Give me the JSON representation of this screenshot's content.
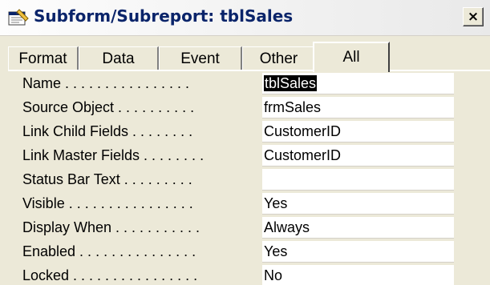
{
  "window": {
    "title": "Subform/Subreport: tblSales",
    "close_label": "×"
  },
  "tabs": [
    {
      "label": "Format",
      "active": false
    },
    {
      "label": "Data",
      "active": false
    },
    {
      "label": "Event",
      "active": false
    },
    {
      "label": "Other",
      "active": false
    },
    {
      "label": "All",
      "active": true
    }
  ],
  "properties": [
    {
      "label": "Name . . . . . . . . . . . . . . . .",
      "value": "tblSales"
    },
    {
      "label": "Source Object . . . . . . . . . .",
      "value": "frmSales"
    },
    {
      "label": "Link Child Fields . . . . . . . .",
      "value": "CustomerID"
    },
    {
      "label": "Link Master Fields . . . . . . . .",
      "value": "CustomerID"
    },
    {
      "label": "Status Bar Text . . . . . . . . .",
      "value": ""
    },
    {
      "label": "Visible . . . . . . . . . . . . . . . .",
      "value": "Yes"
    },
    {
      "label": "Display When . . . . . . . . . . .",
      "value": "Always"
    },
    {
      "label": "Enabled . . . . . . . . . . . . . . .",
      "value": "Yes"
    },
    {
      "label": "Locked . . . . . . . . . . . . . . . .",
      "value": "No"
    }
  ],
  "colors": {
    "window_bg": "#ece9d8",
    "title_text": "#0a246a",
    "selection_bg": "#000000",
    "value_bg": "#ffffff"
  },
  "icons": {
    "app": "property-sheet-icon",
    "close": "close-icon"
  }
}
